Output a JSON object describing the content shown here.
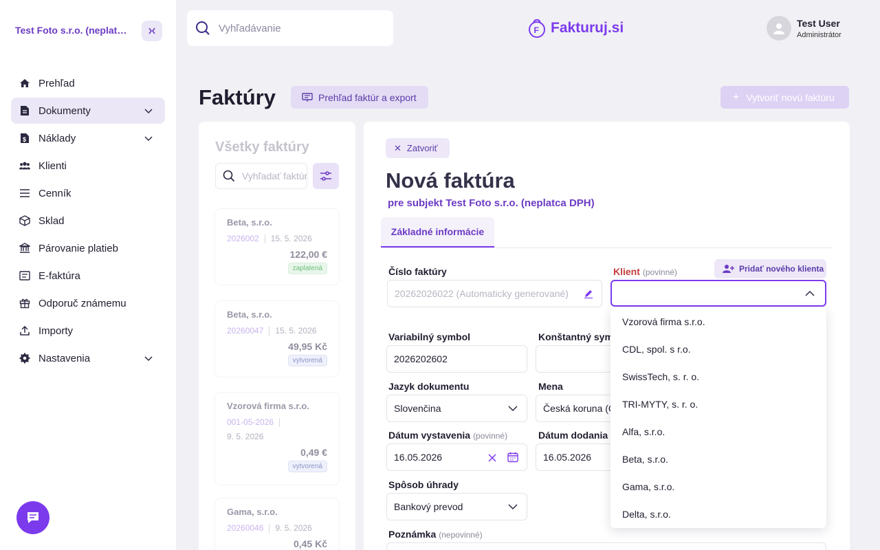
{
  "sidebar": {
    "company": "Test Foto s.r.o. (neplatca DPH)",
    "collapse_label": "><",
    "items": [
      {
        "label": "Prehľad",
        "icon": "home-icon",
        "expandable": false,
        "active": false
      },
      {
        "label": "Dokumenty",
        "icon": "document-icon",
        "expandable": true,
        "active": true
      },
      {
        "label": "Náklady",
        "icon": "expense-icon",
        "expandable": true,
        "active": false
      },
      {
        "label": "Klienti",
        "icon": "users-icon",
        "expandable": false,
        "active": false
      },
      {
        "label": "Cenník",
        "icon": "list-icon",
        "expandable": false,
        "active": false
      },
      {
        "label": "Sklad",
        "icon": "box-icon",
        "expandable": false,
        "active": false
      },
      {
        "label": "Párovanie platieb",
        "icon": "bank-icon",
        "expandable": false,
        "active": false
      },
      {
        "label": "E-faktúra",
        "icon": "einvoice-icon",
        "expandable": false,
        "active": false
      },
      {
        "label": "Odporuč známemu",
        "icon": "gift-icon",
        "expandable": false,
        "active": false
      },
      {
        "label": "Importy",
        "icon": "upload-icon",
        "expandable": false,
        "active": false
      },
      {
        "label": "Nastavenia",
        "icon": "gear-icon",
        "expandable": true,
        "active": false
      }
    ]
  },
  "topbar": {
    "search_placeholder": "Vyhľadávanie",
    "logo_text": "Fakturuj.si",
    "user_name": "Test User",
    "user_role": "Administrátor"
  },
  "header": {
    "title": "Faktúry",
    "overview_label": "Prehľad faktúr a export",
    "create_label": "Vytvoriť novú faktúru"
  },
  "invoice_list": {
    "title": "Všetky faktúry",
    "search_placeholder": "Vyhľadať faktúru",
    "cards": [
      {
        "client": "Beta, s.r.o.",
        "number": "2026002",
        "date": "15. 5. 2026",
        "amount": "122,00 €",
        "status": "zaplatená",
        "status_type": "paid"
      },
      {
        "client": "Beta, s.r.o.",
        "number": "20260047",
        "date": "15. 5. 2026",
        "amount": "49,95 Kč",
        "status": "vytvorená",
        "status_type": "created"
      },
      {
        "client": "Vzorová firma s.r.o.",
        "number": "001-05-2026",
        "date": "9. 5. 2026",
        "amount": "0,49 €",
        "status": "vytvorená",
        "status_type": "created"
      },
      {
        "client": "Gama, s.r.o.",
        "number": "20260046",
        "date": "9. 5. 2026",
        "amount": "0,45 Kč",
        "status": "",
        "status_type": ""
      }
    ]
  },
  "form": {
    "close_label": "Zatvoriť",
    "title": "Nová faktúra",
    "subtitle": "pre subjekt Test Foto s.r.o. (neplatca DPH)",
    "tab": "Základné informácie",
    "invoice_number_label": "Číslo faktúry",
    "invoice_number_value": "20262026022 (Automaticky generované)",
    "client_label": "Klient",
    "client_required": "(povinné)",
    "add_client_label": "Pridať nového klienta",
    "variable_symbol_label": "Variabilný symbol",
    "variable_symbol_value": "2026202602",
    "constant_symbol_label": "Konštantný symbol",
    "language_label": "Jazyk dokumentu",
    "language_value": "Slovenčina",
    "currency_label": "Mena",
    "currency_value": "Česká koruna (CZK)",
    "issue_date_label": "Dátum vystavenia",
    "issue_date_required": "(povinné)",
    "issue_date_value": "16.05.2026",
    "delivery_date_label": "Dátum dodania",
    "delivery_date_value": "16.05.2026",
    "payment_label": "Spôsob úhrady",
    "payment_value": "Bankový prevod",
    "note_label": "Poznámka",
    "note_optional": "(nepovinné)"
  },
  "client_dropdown": {
    "options": [
      "Vzorová firma s.r.o.",
      "CDL, spol. s r.o.",
      "SwissTech, s. r. o.",
      "TRI-MYTY, s. r. o.",
      "Alfa, s.r.o.",
      "Beta, s.r.o.",
      "Gama, s.r.o.",
      "Delta, s.r.o."
    ]
  },
  "colors": {
    "accent": "#7c3aed",
    "accent_light": "#ece7f7",
    "required": "#c23b3b"
  }
}
